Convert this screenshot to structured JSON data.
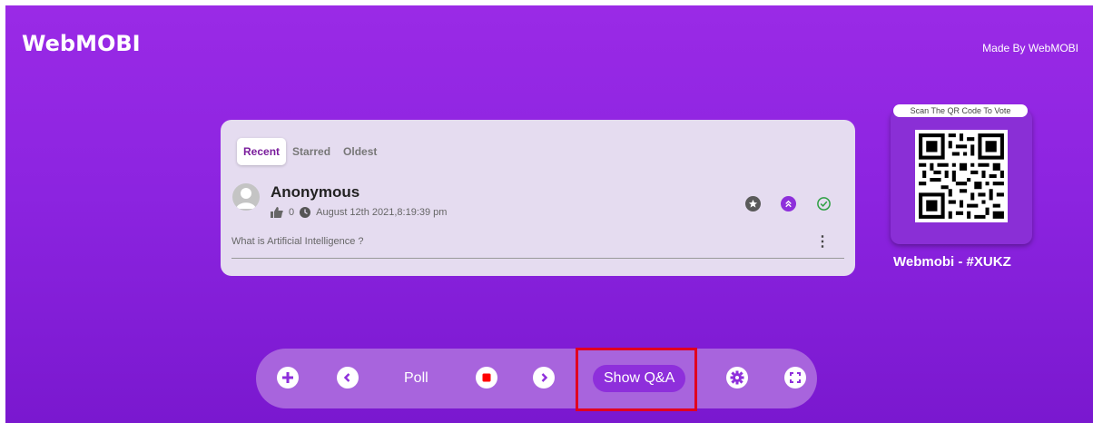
{
  "header": {
    "brand": "WebMOBI",
    "made_by": "Made By WebMOBI"
  },
  "qa": {
    "tabs": [
      {
        "label": "Recent",
        "active": true
      },
      {
        "label": "Starred",
        "active": false
      },
      {
        "label": "Oldest",
        "active": false
      }
    ],
    "question": {
      "author": "Anonymous",
      "likes": "0",
      "timestamp": "August 12th 2021,8:19:39 pm",
      "text": "What is Artificial Intelligence ?",
      "more": "⋮"
    }
  },
  "qr": {
    "caption": "Scan The QR Code To Vote",
    "event": "Webmobi - #XUKZ"
  },
  "toolbar": {
    "poll_label": "Poll",
    "show_qa_label": "Show Q&A"
  },
  "colors": {
    "background_top": "#9a2ae6",
    "background_bottom": "#7a18cf",
    "card": "#e5dcf0",
    "accent": "#8e2fdb",
    "stop": "#ff0000",
    "approve": "#2ea043",
    "highlight": "#e10020"
  },
  "icons": [
    "add-icon",
    "chevron-left-icon",
    "stop-icon",
    "chevron-right-icon",
    "gear-icon",
    "fullscreen-icon",
    "star-icon",
    "double-chevron-up-icon",
    "check-circle-icon",
    "thumbs-up-icon",
    "clock-icon",
    "user-icon"
  ]
}
